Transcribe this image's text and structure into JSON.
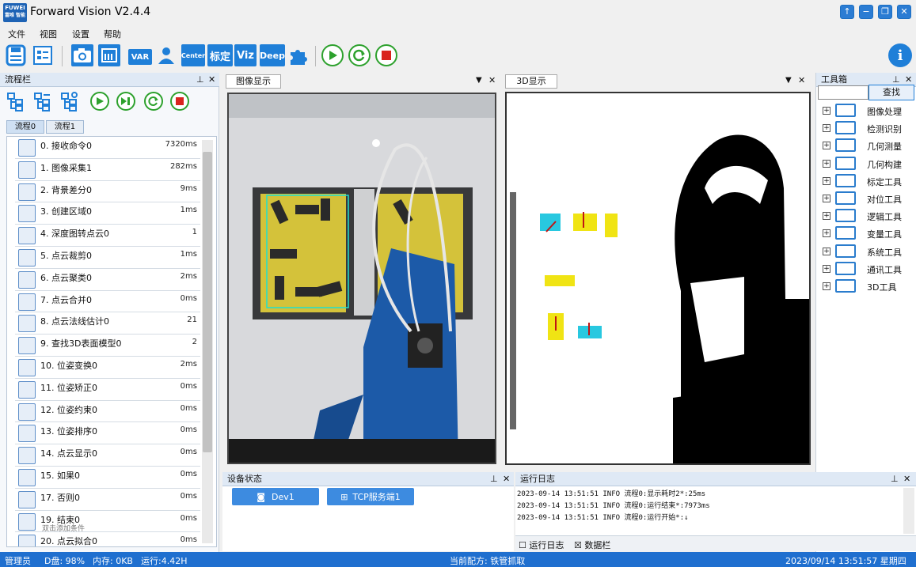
{
  "app": {
    "logo_text": "FUWEI",
    "logo_sub": "富唯 智能",
    "title": "Forward Vision V2.4.4"
  },
  "window_buttons": [
    "↑",
    "−",
    "❐",
    "✕"
  ],
  "menu": [
    "文件",
    "视图",
    "设置",
    "帮助"
  ],
  "toolbar": {
    "var_label": "VAR",
    "center_label": "Center",
    "calib_label": "标定",
    "viz_label": "Viz",
    "deep_label": "Deep",
    "info_label": "i"
  },
  "flow_panel": {
    "title": "流程栏",
    "tabs": [
      "流程0",
      "流程1"
    ],
    "items": [
      {
        "name": "0. 接收命令0",
        "time": "7320ms"
      },
      {
        "name": "1. 图像采集1",
        "time": "282ms"
      },
      {
        "name": "2. 背景差分0",
        "time": "9ms"
      },
      {
        "name": "3. 创建区域0",
        "time": "1ms"
      },
      {
        "name": "4. 深度图转点云0",
        "time": "1"
      },
      {
        "name": "5. 点云裁剪0",
        "time": "1ms"
      },
      {
        "name": "6. 点云聚类0",
        "time": "2ms"
      },
      {
        "name": "7. 点云合并0",
        "time": "0ms"
      },
      {
        "name": "8. 点云法线估计0",
        "time": "21"
      },
      {
        "name": "9. 查找3D表面模型0",
        "time": "2"
      },
      {
        "name": "10. 位姿变换0",
        "time": "2ms"
      },
      {
        "name": "11. 位姿矫正0",
        "time": "0ms"
      },
      {
        "name": "12. 位姿约束0",
        "time": "0ms"
      },
      {
        "name": "13. 位姿排序0",
        "time": "0ms"
      },
      {
        "name": "14. 点云显示0",
        "time": "0ms"
      },
      {
        "name": "15. 如果0",
        "time": "0ms"
      },
      {
        "name": "17. 否则0",
        "time": "0ms"
      },
      {
        "name": "19. 结束0",
        "time": "0ms",
        "sub": "双击添加条件"
      },
      {
        "name": "20. 点云拟合0",
        "time": "0ms"
      }
    ]
  },
  "image_panel": {
    "title": "图像显示"
  },
  "d3_panel": {
    "title": "3D显示"
  },
  "toolbox": {
    "title": "工具箱",
    "search_label": "查找",
    "items": [
      "图像处理",
      "检测识别",
      "几何测量",
      "几何构建",
      "标定工具",
      "对位工具",
      "逻辑工具",
      "变量工具",
      "系统工具",
      "通讯工具",
      "3D工具"
    ]
  },
  "device_panel": {
    "title": "设备状态",
    "devices": [
      "Dev1",
      "TCP服务端1"
    ]
  },
  "log_panel": {
    "title": "运行日志",
    "lines": [
      "2023-09-14 13:51:51 INFO  流程0:显示耗时2*:25ms",
      "2023-09-14 13:51:51 INFO  流程0:运行结束*:7973ms",
      "2023-09-14 13:51:51 INFO  流程0:运行开始*:↓"
    ],
    "tabs": [
      "运行日志",
      "数据栏"
    ]
  },
  "statusbar": {
    "user": "管理员",
    "disk": "D盘: 98%",
    "memory": "内存: 0KB",
    "runtime": "运行:4.42H",
    "recipe": "当前配方: 铁管抓取",
    "datetime": "2023/09/14 13:51:57 星期四"
  },
  "colors": {
    "accent": "#1f6fcf",
    "panel_header": "#dfe9f5",
    "run_green": "#2da12d",
    "stop_red": "#d9231d"
  }
}
